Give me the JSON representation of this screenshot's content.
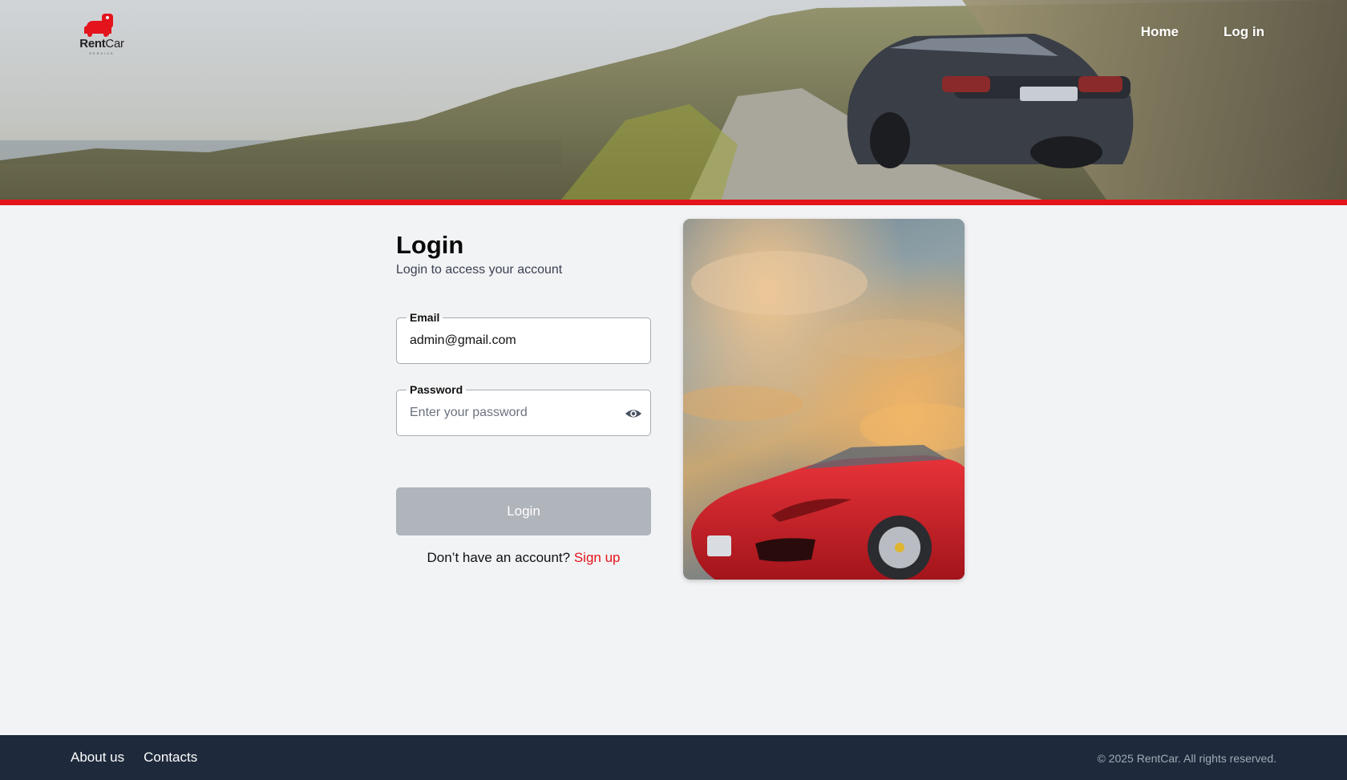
{
  "header": {
    "logo": {
      "word_bold": "Rent",
      "word_light": "Car",
      "tagline": "SERVICE"
    },
    "nav": {
      "home": "Home",
      "login": "Log in"
    }
  },
  "login": {
    "title": "Login",
    "subtitle": "Login to access your account",
    "email": {
      "label": "Email",
      "value": "admin@gmail.com"
    },
    "password": {
      "label": "Password",
      "placeholder": "Enter your password",
      "value": ""
    },
    "submit_label": "Login",
    "signup_prompt": "Don’t have an account?",
    "signup_link": "Sign up"
  },
  "footer": {
    "about": "About us",
    "contacts": "Contacts",
    "copyright": "© 2025 RentCar. All rights reserved."
  },
  "colors": {
    "accent_red": "#e3141b",
    "footer_bg": "#1e293b",
    "page_bg": "#f2f3f5",
    "disabled_button": "#b0b4bb"
  },
  "icons": {
    "logo": "car-key-logo-icon",
    "password_toggle": "eye-icon"
  }
}
